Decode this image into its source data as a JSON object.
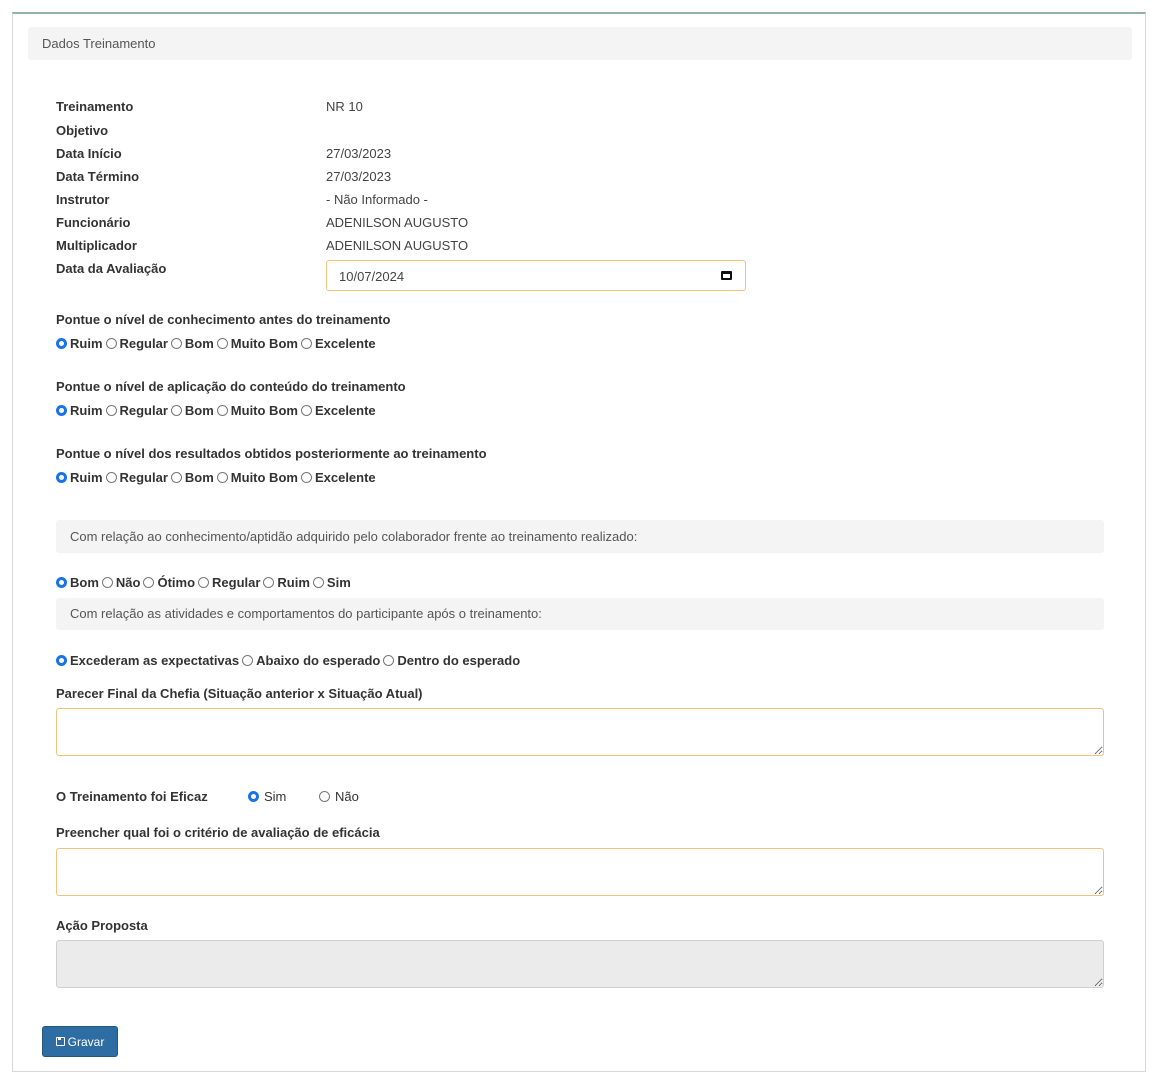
{
  "panel": {
    "title": "Dados Treinamento"
  },
  "details": [
    {
      "label": "Treinamento",
      "value": "NR 10"
    },
    {
      "label": "Objetivo",
      "value": ""
    },
    {
      "label": "Data Início",
      "value": "27/03/2023"
    },
    {
      "label": "Data Término",
      "value": "27/03/2023"
    },
    {
      "label": "Instrutor",
      "value": "- Não Informado -"
    },
    {
      "label": "Funcionário",
      "value": "ADENILSON AUGUSTO"
    },
    {
      "label": "Multiplicador",
      "value": "ADENILSON AUGUSTO"
    }
  ],
  "evaluation_date": {
    "label": "Data da Avaliação",
    "value": "10/07/2024"
  },
  "questions": [
    {
      "text": "Pontue o nível de conhecimento antes do treinamento",
      "options": [
        "Ruim",
        "Regular",
        "Bom",
        "Muito Bom",
        "Excelente"
      ],
      "selected": "Ruim"
    },
    {
      "text": "Pontue o nível de aplicação do conteúdo do treinamento",
      "options": [
        "Ruim",
        "Regular",
        "Bom",
        "Muito Bom",
        "Excelente"
      ],
      "selected": "Ruim"
    },
    {
      "text": "Pontue o nível dos resultados obtidos posteriormente ao treinamento",
      "options": [
        "Ruim",
        "Regular",
        "Bom",
        "Muito Bom",
        "Excelente"
      ],
      "selected": "Ruim"
    }
  ],
  "knowledge": {
    "note": "Com relação ao conhecimento/aptidão adquirido pelo colaborador frente ao treinamento realizado:",
    "options": [
      "Bom",
      "Não",
      "Ótimo",
      "Regular",
      "Ruim",
      "Sim"
    ],
    "selected": "Bom"
  },
  "behavior": {
    "note": "Com relação as atividades e comportamentos do participante após o treinamento:",
    "options": [
      "Excederam as expectativas",
      "Abaixo do esperado",
      "Dentro do esperado"
    ],
    "selected": "Excederam as expectativas"
  },
  "parecer": {
    "label": "Parecer Final da Chefia (Situação anterior x Situação Atual)",
    "value": ""
  },
  "eficaz": {
    "label": "O Treinamento foi Eficaz",
    "yes": "Sim",
    "no": "Não",
    "selected": "Sim"
  },
  "criterio": {
    "label": "Preencher qual foi o critério de avaliação de eficácia",
    "value": ""
  },
  "acao": {
    "label": "Ação Proposta",
    "value": ""
  },
  "save_button": {
    "label": "Gravar",
    "icon": "floppy-disk-icon"
  },
  "colors": {
    "primary_button": "#2e6da4",
    "radio_checked": "#1a73e8",
    "input_border": "#f0c27b"
  }
}
